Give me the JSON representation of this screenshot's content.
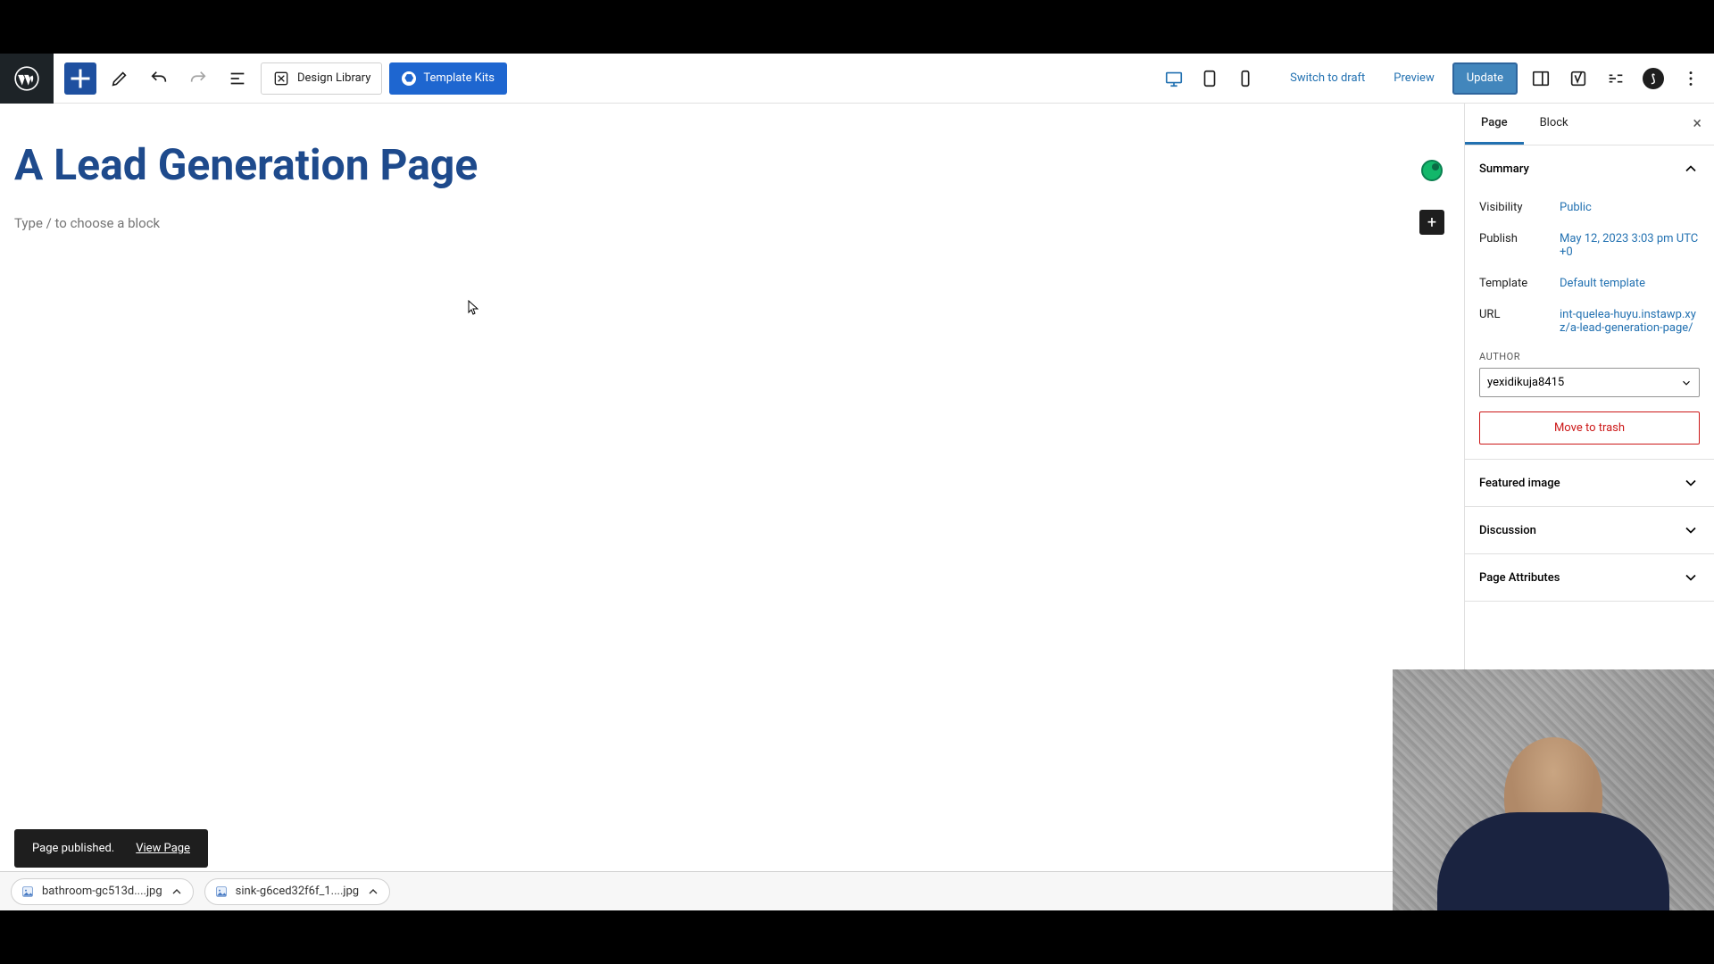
{
  "toolbar": {
    "design_library": "Design Library",
    "template_kits": "Template Kits",
    "switch_draft": "Switch to draft",
    "preview": "Preview",
    "update": "Update"
  },
  "editor": {
    "title": "A Lead Generation Page",
    "placeholder": "Type / to choose a block"
  },
  "sidebar": {
    "tabs": {
      "page": "Page",
      "block": "Block"
    },
    "panels": {
      "summary": "Summary",
      "featured_image": "Featured image",
      "discussion": "Discussion",
      "page_attributes": "Page Attributes"
    },
    "summary": {
      "visibility_label": "Visibility",
      "visibility_value": "Public",
      "publish_label": "Publish",
      "publish_value": "May 12, 2023 3:03 pm UTC+0",
      "template_label": "Template",
      "template_value": "Default template",
      "url_label": "URL",
      "url_value": "int-quelea-huyu.instawp.xyz/a-lead-generation-page/",
      "author_label": "AUTHOR",
      "author_value": "yexidikuja8415",
      "trash": "Move to trash"
    }
  },
  "toast": {
    "message": "Page published.",
    "action": "View Page"
  },
  "breadcrumb": "Page",
  "downloads": [
    {
      "name": "bathroom-gc513d....jpg"
    },
    {
      "name": "sink-g6ced32f6f_1....jpg"
    }
  ]
}
